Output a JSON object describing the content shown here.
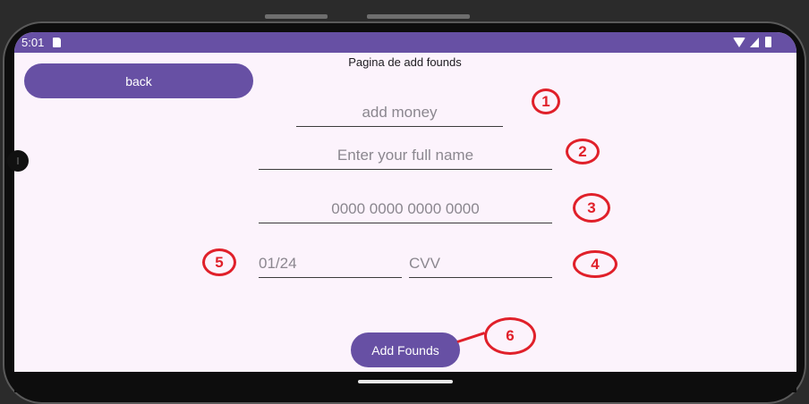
{
  "status": {
    "time": "5:01"
  },
  "page": {
    "title": "Pagina de add founds",
    "back_label": "back",
    "money_placeholder": "add money",
    "name_placeholder": "Enter your full name",
    "card_placeholder": "0000 0000 0000 0000",
    "date_placeholder": "01/24",
    "cvv_placeholder": "CVV",
    "submit_label": "Add Founds"
  },
  "annotations": [
    "1",
    "2",
    "3",
    "4",
    "5",
    "6"
  ],
  "colors": {
    "primary": "#6750a4",
    "background": "#fcf3fc",
    "annotation": "#e0202a"
  },
  "icons": [
    "sd-card-icon",
    "wifi-icon",
    "signal-icon",
    "battery-icon"
  ]
}
